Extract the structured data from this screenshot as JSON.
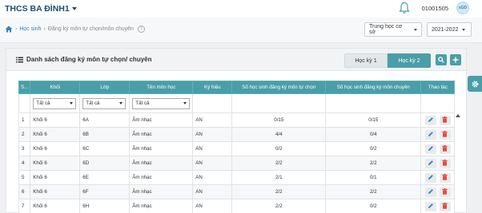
{
  "header": {
    "school_name": "THCS BA ĐÌNH1",
    "user_id": "01001505",
    "avatar_text": "sGD"
  },
  "breadcrumb": {
    "items": [
      "Học sinh",
      "Đăng ký môn tự chọn/môn chuyên"
    ],
    "separator": "›",
    "help": "?"
  },
  "filters": {
    "level": "Trung học cơ sở",
    "year": "2021-2022"
  },
  "card": {
    "title": "Danh sách đăng ký môn tự chọn/ chuyên",
    "tabs": [
      "Học kỳ 1",
      "Học kỳ 2"
    ],
    "active_tab": "Học kỳ 2"
  },
  "table": {
    "columns": [
      "S...",
      "Khối",
      "Lớp",
      "Tên môn học",
      "Ký hiệu",
      "Số học sinh đăng ký môn tự chọn",
      "Số học sinh đăng ký môn chuyên",
      "Thao tác"
    ],
    "filter_all": "Tất cả",
    "rows": [
      {
        "stt": "1",
        "khoi": "Khối 6",
        "lop": "6A",
        "mon": "Âm nhạc",
        "ky_hieu": "AN",
        "tu_chon": "0/15",
        "chuyen": "0/15"
      },
      {
        "stt": "2",
        "khoi": "Khối 6",
        "lop": "6B",
        "mon": "Âm nhạc",
        "ky_hieu": "AN",
        "tu_chon": "4/4",
        "chuyen": "0/4"
      },
      {
        "stt": "3",
        "khoi": "Khối 6",
        "lop": "6C",
        "mon": "Âm nhạc",
        "ky_hieu": "AN",
        "tu_chon": "0/2",
        "chuyen": "0/2"
      },
      {
        "stt": "4",
        "khoi": "Khối 6",
        "lop": "6D",
        "mon": "Âm nhạc",
        "ky_hieu": "AN",
        "tu_chon": "2/2",
        "chuyen": "2/2"
      },
      {
        "stt": "5",
        "khoi": "Khối 6",
        "lop": "6E",
        "mon": "Âm nhạc",
        "ky_hieu": "AN",
        "tu_chon": "2/1",
        "chuyen": "0/1"
      },
      {
        "stt": "6",
        "khoi": "Khối 6",
        "lop": "6F",
        "mon": "Âm nhạc",
        "ky_hieu": "AN",
        "tu_chon": "2/2",
        "chuyen": "2/2"
      },
      {
        "stt": "7",
        "khoi": "Khối 6",
        "lop": "6H",
        "mon": "Âm nhạc",
        "ky_hieu": "AN",
        "tu_chon": "2/2",
        "chuyen": "0/2"
      }
    ]
  },
  "colors": {
    "accent": "#4a9ea8",
    "brand": "#1b4f72",
    "delete": "#e74c3c",
    "edit": "#3a8fb7"
  },
  "icons": [
    "bell-icon",
    "home-icon",
    "help-icon",
    "list-icon",
    "search-icon",
    "plus-icon",
    "edit-icon",
    "delete-icon",
    "gear-icon"
  ]
}
